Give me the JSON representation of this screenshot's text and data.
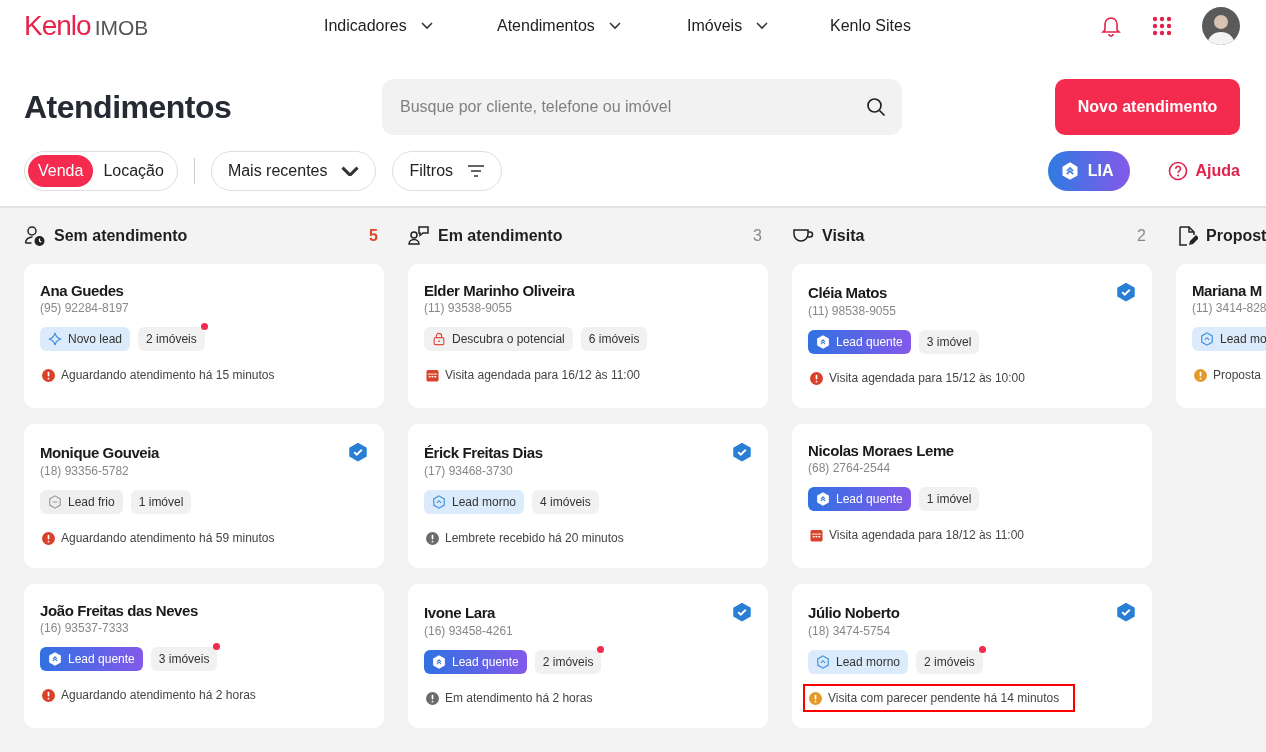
{
  "logo": {
    "brand": "Kenlo",
    "product": "IMOB"
  },
  "nav": [
    {
      "label": "Indicadores",
      "dropdown": true
    },
    {
      "label": "Atendimentos",
      "dropdown": true
    },
    {
      "label": "Imóveis",
      "dropdown": true
    },
    {
      "label": "Kenlo Sites",
      "dropdown": false
    }
  ],
  "page_title": "Atendimentos",
  "search": {
    "placeholder": "Busque por cliente, telefone ou imóvel"
  },
  "primary_button": "Novo atendimento",
  "segments": [
    {
      "label": "Venda",
      "selected": true
    },
    {
      "label": "Locação",
      "selected": false
    }
  ],
  "sort": "Mais recentes",
  "filters": "Filtros",
  "lia_button": "LIA",
  "help_link": "Ajuda",
  "columns": [
    {
      "title": "Sem atendimento",
      "kind": "waiting",
      "count": "5",
      "urgent": true,
      "cards": [
        {
          "name": "Ana Guedes",
          "phone": "(95) 92284-8197",
          "verified": false,
          "tag": {
            "kind": "novo",
            "label": "Novo lead"
          },
          "properties": {
            "label": "2 imóveis",
            "dot": true
          },
          "status": {
            "kind": "alert",
            "color": "#d9412b",
            "text": "Aguardando atendimento há 15 minutos",
            "highlighted": false
          }
        },
        {
          "name": "Monique Gouveia",
          "phone": "(18) 93356-5782",
          "verified": true,
          "tag": {
            "kind": "frio",
            "label": "Lead frio"
          },
          "properties": {
            "label": "1 imóvel",
            "dot": false
          },
          "status": {
            "kind": "alert",
            "color": "#d9412b",
            "text": "Aguardando atendimento há 59 minutos",
            "highlighted": false
          }
        },
        {
          "name": "João Freitas das Neves",
          "phone": "(16) 93537-7333",
          "verified": false,
          "tag": {
            "kind": "quente",
            "label": "Lead quente"
          },
          "properties": {
            "label": "3 imóveis",
            "dot": true
          },
          "status": {
            "kind": "alert",
            "color": "#d9412b",
            "text": "Aguardando atendimento há 2 horas",
            "highlighted": false
          }
        }
      ]
    },
    {
      "title": "Em atendimento",
      "kind": "chat",
      "count": "3",
      "urgent": false,
      "cards": [
        {
          "name": "Elder Marinho Oliveira",
          "phone": "(11) 93538-9055",
          "verified": false,
          "tag": {
            "kind": "potencial",
            "label": "Descubra o potencial"
          },
          "properties": {
            "label": "6 imóveis",
            "dot": false
          },
          "status": {
            "kind": "calendar",
            "color": "#d9412b",
            "text": "Visita agendada para 16/12 às 11:00",
            "highlighted": false
          }
        },
        {
          "name": "Érick Freitas Dias",
          "phone": "(17) 93468-3730",
          "verified": true,
          "tag": {
            "kind": "morno",
            "label": "Lead morno"
          },
          "properties": {
            "label": "4 imóveis",
            "dot": false
          },
          "status": {
            "kind": "alert",
            "color": "#6b6b6b",
            "text": "Lembrete recebido há 20 minutos",
            "highlighted": false
          }
        },
        {
          "name": "Ivone Lara",
          "phone": "(16) 93458-4261",
          "verified": true,
          "tag": {
            "kind": "quente",
            "label": "Lead quente"
          },
          "properties": {
            "label": "2 imóveis",
            "dot": true
          },
          "status": {
            "kind": "alert",
            "color": "#6b6b6b",
            "text": "Em atendimento há 2 horas",
            "highlighted": false
          }
        }
      ]
    },
    {
      "title": "Visita",
      "kind": "cup",
      "count": "2",
      "urgent": false,
      "cards": [
        {
          "name": "Cléia Matos",
          "phone": "(11) 98538-9055",
          "verified": true,
          "tag": {
            "kind": "quente",
            "label": "Lead quente"
          },
          "properties": {
            "label": "3 imóvel",
            "dot": false
          },
          "status": {
            "kind": "alert",
            "color": "#d9412b",
            "text": "Visita agendada para 15/12 às 10:00",
            "highlighted": false
          }
        },
        {
          "name": "Nicolas Moraes Leme",
          "phone": "(68) 2764-2544",
          "verified": false,
          "tag": {
            "kind": "quente",
            "label": "Lead quente"
          },
          "properties": {
            "label": "1 imóvel",
            "dot": false
          },
          "status": {
            "kind": "calendar",
            "color": "#d9412b",
            "text": "Visita agendada para 18/12 às 11:00",
            "highlighted": false
          }
        },
        {
          "name": "Júlio Noberto",
          "phone": "(18) 3474-5754",
          "verified": true,
          "tag": {
            "kind": "morno",
            "label": "Lead morno"
          },
          "properties": {
            "label": "2 imóveis",
            "dot": true
          },
          "status": {
            "kind": "alert",
            "color": "#e39a2b",
            "text": "Visita com parecer pendente há 14 minutos",
            "highlighted": true
          }
        }
      ]
    },
    {
      "title": "Propost",
      "kind": "doc",
      "cards": [
        {
          "name": "Mariana M",
          "phone": "(11) 3414-828",
          "verified": false,
          "tag": {
            "kind": "morno",
            "label": "Lead mo"
          },
          "status": {
            "kind": "alert",
            "color": "#e39a2b",
            "text": "Proposta",
            "highlighted": false
          }
        }
      ]
    }
  ]
}
